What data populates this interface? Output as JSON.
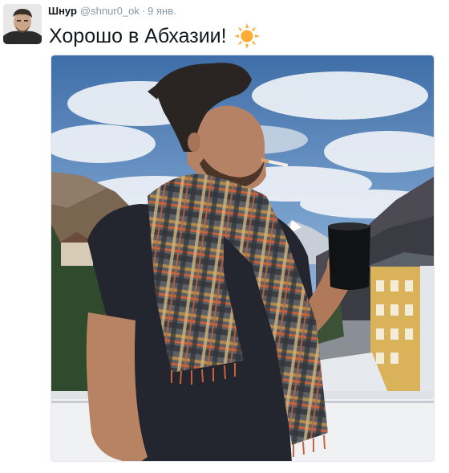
{
  "tweet": {
    "author_name": "Шнур",
    "username": "@shnur0_ok",
    "separator": "·",
    "timestamp": "9 янв.",
    "text": "Хорошо в Абхазии!",
    "emoji_icon": "sun-icon",
    "media_alt": "photo-man-scarf-mug-balcony-mountains"
  },
  "colors": {
    "text": "#14171a",
    "secondary": "#8899a6",
    "sun": "#ffac33"
  }
}
